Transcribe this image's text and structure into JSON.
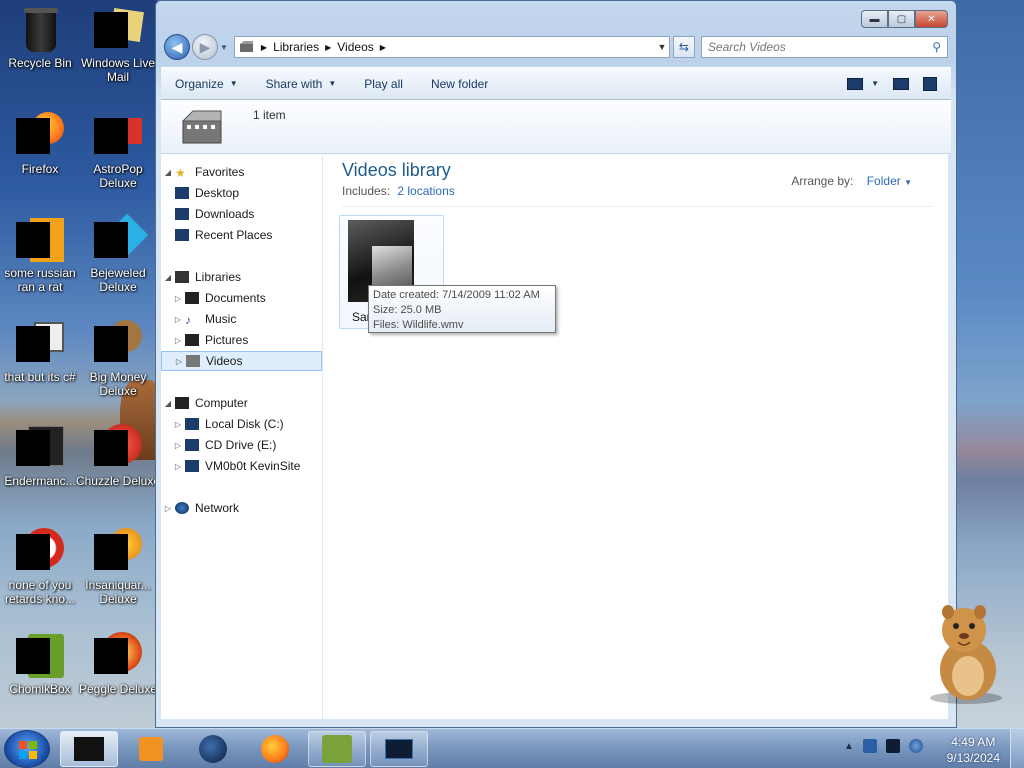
{
  "desktop": {
    "icons": [
      {
        "label": "Recycle Bin"
      },
      {
        "label": "Windows Live Mail"
      },
      {
        "label": "Firefox"
      },
      {
        "label": "AstroPop Deluxe"
      },
      {
        "label": "some russian ran a rat"
      },
      {
        "label": "Bejeweled Deluxe"
      },
      {
        "label": "that but its c#"
      },
      {
        "label": "Big Money Deluxe"
      },
      {
        "label": "Endermanc..."
      },
      {
        "label": "Chuzzle Deluxe"
      },
      {
        "label": "none of you retards kno..."
      },
      {
        "label": "Insaniquar... Deluxe"
      },
      {
        "label": "ChomikBox"
      },
      {
        "label": "Peggle Deluxe"
      }
    ]
  },
  "window": {
    "controls": {
      "minimize": "▬",
      "maximize": "▢",
      "close": "✕"
    },
    "address": {
      "crumbs": [
        "Libraries",
        "Videos"
      ]
    },
    "search": {
      "placeholder": "Search Videos"
    },
    "toolbar": {
      "organize": "Organize",
      "share_with": "Share with",
      "play_all": "Play all",
      "new_folder": "New folder"
    },
    "details": {
      "count": "1 item"
    },
    "sidebar": {
      "favorites": "Favorites",
      "desktop": "Desktop",
      "downloads": "Downloads",
      "recent_places": "Recent Places",
      "libraries": "Libraries",
      "documents": "Documents",
      "music": "Music",
      "pictures": "Pictures",
      "videos": "Videos",
      "computer": "Computer",
      "local_disk": "Local Disk (C:)",
      "cd_drive": "CD Drive (E:)",
      "network_drive": "VM0b0t KevinSite",
      "network": "Network"
    },
    "content": {
      "title": "Videos library",
      "includes_label": "Includes:",
      "locations_link": "2 locations",
      "arrange_label": "Arrange by:",
      "arrange_value": "Folder",
      "folder_label": "Sam"
    },
    "tooltip": {
      "date_created": "Date created: 7/14/2009 11:02 AM",
      "size": "Size: 25.0 MB",
      "files": "Files: Wildlife.wmv"
    }
  },
  "taskbar": {
    "clock_time": "4:49 AM",
    "clock_date": "9/13/2024"
  },
  "colors": {
    "title_blue": "#1e5c8c",
    "link_blue": "#2b6bb3",
    "selection": "#dfeefc"
  }
}
